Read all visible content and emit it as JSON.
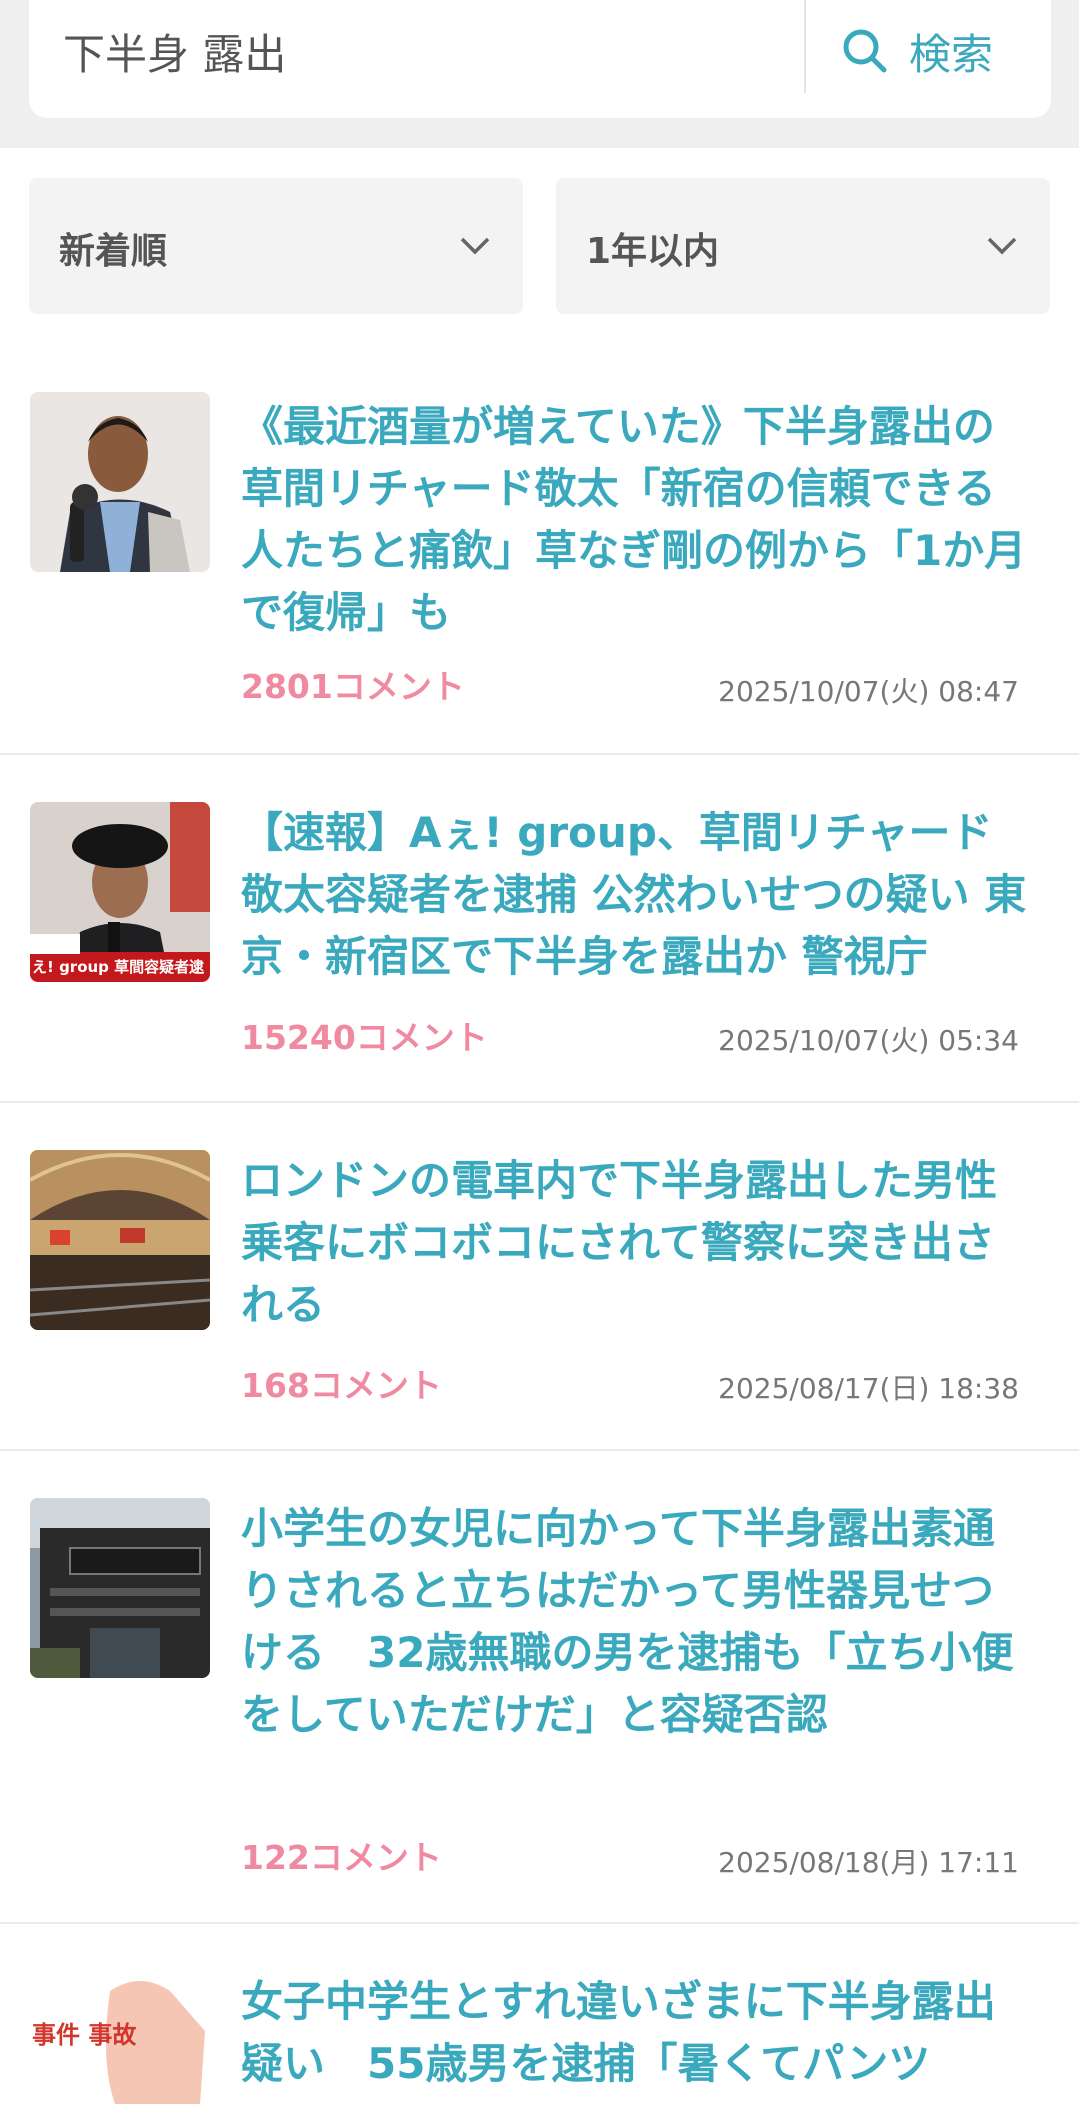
{
  "search": {
    "value": "下半身 露出",
    "button_label": "検索"
  },
  "filters": {
    "sort": "新着順",
    "period": "1年以内"
  },
  "articles": [
    {
      "title": "《最近酒量が増えていた》下半身露出の草間リチャード敬太「新宿の信頼できる人たちと痛飲」草なぎ剛の例から「1か月で復帰」も",
      "comments": "2801コメント",
      "date": "2025/10/07(火) 08:47"
    },
    {
      "title": "【速報】Aぇ! group、草間リチャード敬太容疑者を逮捕 公然わいせつの疑い 東京・新宿区で下半身を露出か 警視庁",
      "comments": "15240コメント",
      "date": "2025/10/07(火) 05:34",
      "thumb_caption": "え! group 草間容疑者逮"
    },
    {
      "title": "ロンドンの電車内で下半身露出した男性　乗客にボコボコにされて警察に突き出される",
      "comments": "168コメント",
      "date": "2025/08/17(日) 18:38"
    },
    {
      "title": "小学生の女児に向かって下半身露出素通りされると立ちはだかって男性器見せつける　32歳無職の男を逮捕も「立ち小便をしていただけだ」と容疑否認",
      "comments": "122コメント",
      "date": "2025/08/18(月) 17:11"
    },
    {
      "title": "女子中学生とすれ違いざまに下半身露出疑い　55歳男を逮捕「暑くてパンツ",
      "thumb_caption": "事件 事故"
    }
  ],
  "colors": {
    "title": "#3aa9bd",
    "comments": "#f08aa0",
    "accent": "#3aa9bd"
  }
}
